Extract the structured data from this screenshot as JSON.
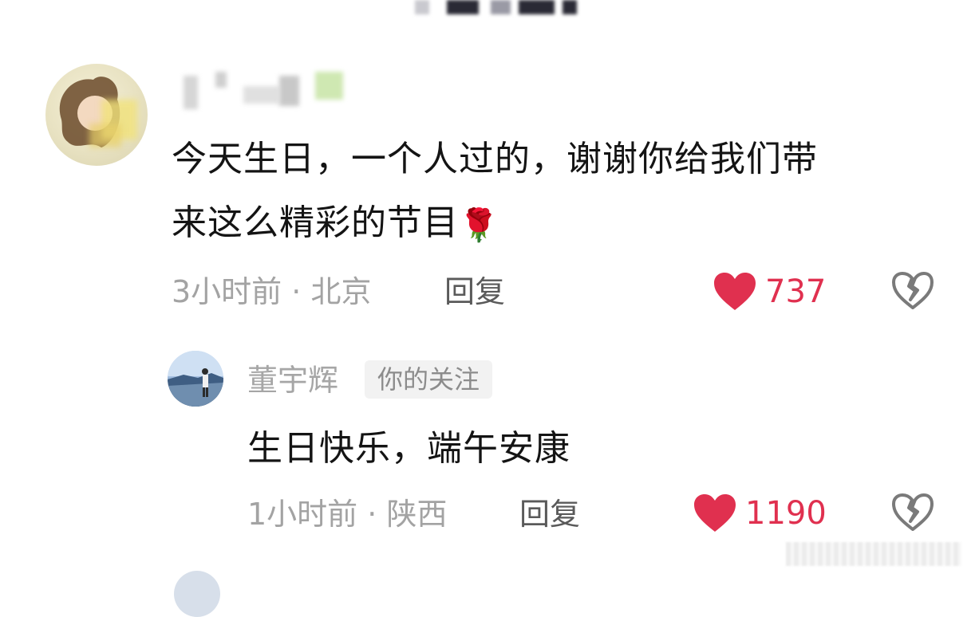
{
  "comment": {
    "text_line1": "今天生日，一个人过的，谢谢你给我们带",
    "text_line2": "来这么精彩的节目",
    "emoji": "🌹",
    "time": "3小时前",
    "separator": " · ",
    "location": "北京",
    "reply_label": "回复",
    "like_count": "737"
  },
  "reply": {
    "username": "董宇辉",
    "badge": "你的关注",
    "text": "生日快乐，端午安康",
    "time": "1小时前",
    "separator": " · ",
    "location": "陕西",
    "reply_label": "回复",
    "like_count": "1190"
  },
  "colors": {
    "like": "#e0304f",
    "meta": "#a3a3a3",
    "text": "#141414"
  },
  "icons": {
    "like": "heart-icon",
    "dislike": "broken-heart-icon"
  }
}
